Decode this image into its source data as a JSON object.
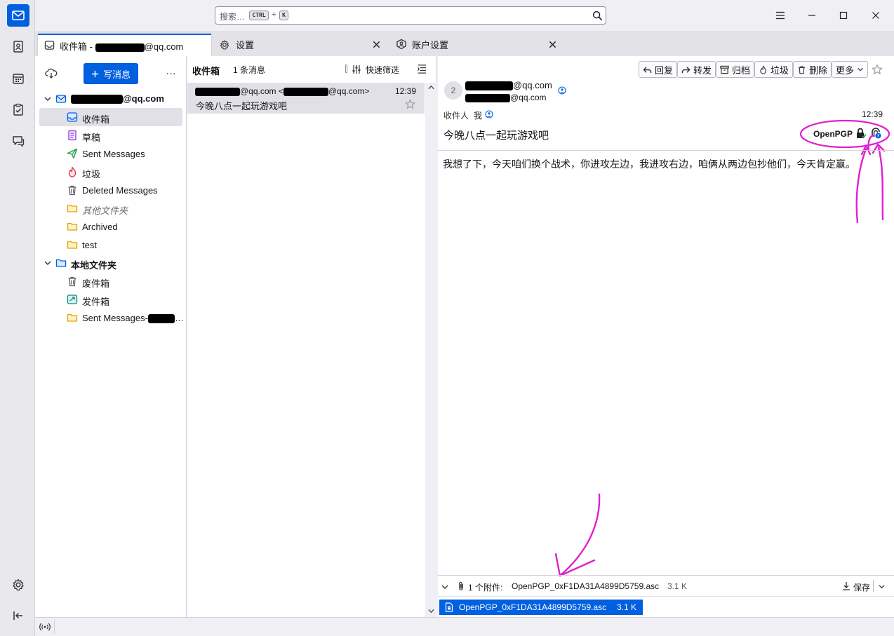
{
  "search": {
    "placeholder": "搜索…",
    "key_ctrl": "CTRL",
    "key_plus": "+",
    "key_k": "K"
  },
  "tabs": [
    {
      "label_prefix": "收件箱 - ",
      "label_suffix": "@qq.com"
    },
    {
      "label": "设置"
    },
    {
      "label": "账户设置"
    }
  ],
  "folder_pane": {
    "compose_label": "写消息",
    "more": "…",
    "account": {
      "suffix": "@qq.com"
    },
    "folders": [
      {
        "label": "收件箱"
      },
      {
        "label": "草稿"
      },
      {
        "label": "Sent Messages"
      },
      {
        "label": "垃圾"
      },
      {
        "label": "Deleted Messages"
      },
      {
        "label": "其他文件夹"
      },
      {
        "label": "Archived"
      },
      {
        "label": "test"
      }
    ],
    "local": {
      "label": "本地文件夹"
    },
    "local_folders": [
      {
        "label": "废件箱"
      },
      {
        "label": "发件箱"
      },
      {
        "label": "Sent Messages-"
      }
    ],
    "local_ellipsis": "…"
  },
  "thread_pane": {
    "folder_name": "收件箱",
    "count": "1 条消息",
    "quick_filter": "快速筛选",
    "message": {
      "from_mid": "@qq.com <",
      "from_end": "@qq.com>",
      "time": "12:39",
      "subject": "今晚八点一起玩游戏吧"
    }
  },
  "toolbar": {
    "reply": "回复",
    "forward": "转发",
    "archive": "归档",
    "junk": "垃圾",
    "delete": "删除",
    "more": "更多"
  },
  "header": {
    "avatar": "2",
    "from_suffix": "@qq.com",
    "from_email_suffix": "@qq.com",
    "to_label": "收件人",
    "to_value": "我",
    "time": "12:39",
    "subject": "今晚八点一起玩游戏吧",
    "openpgp": "OpenPGP"
  },
  "body": {
    "text": "我想了下，今天咱们换个战术，你进攻左边，我进攻右边，咱俩从两边包抄他们，今天肯定赢。"
  },
  "attachments": {
    "summary_label": "1 个附件:",
    "filename": "OpenPGP_0xF1DA31A4899D5759.asc",
    "size": "3.1 K",
    "save": "保存",
    "chip_name": "OpenPGP_0xF1DA31A4899D5759.asc",
    "chip_size": "3.1 K"
  },
  "colors": {
    "accent": "#0060df",
    "annotation": "#e020d0"
  }
}
